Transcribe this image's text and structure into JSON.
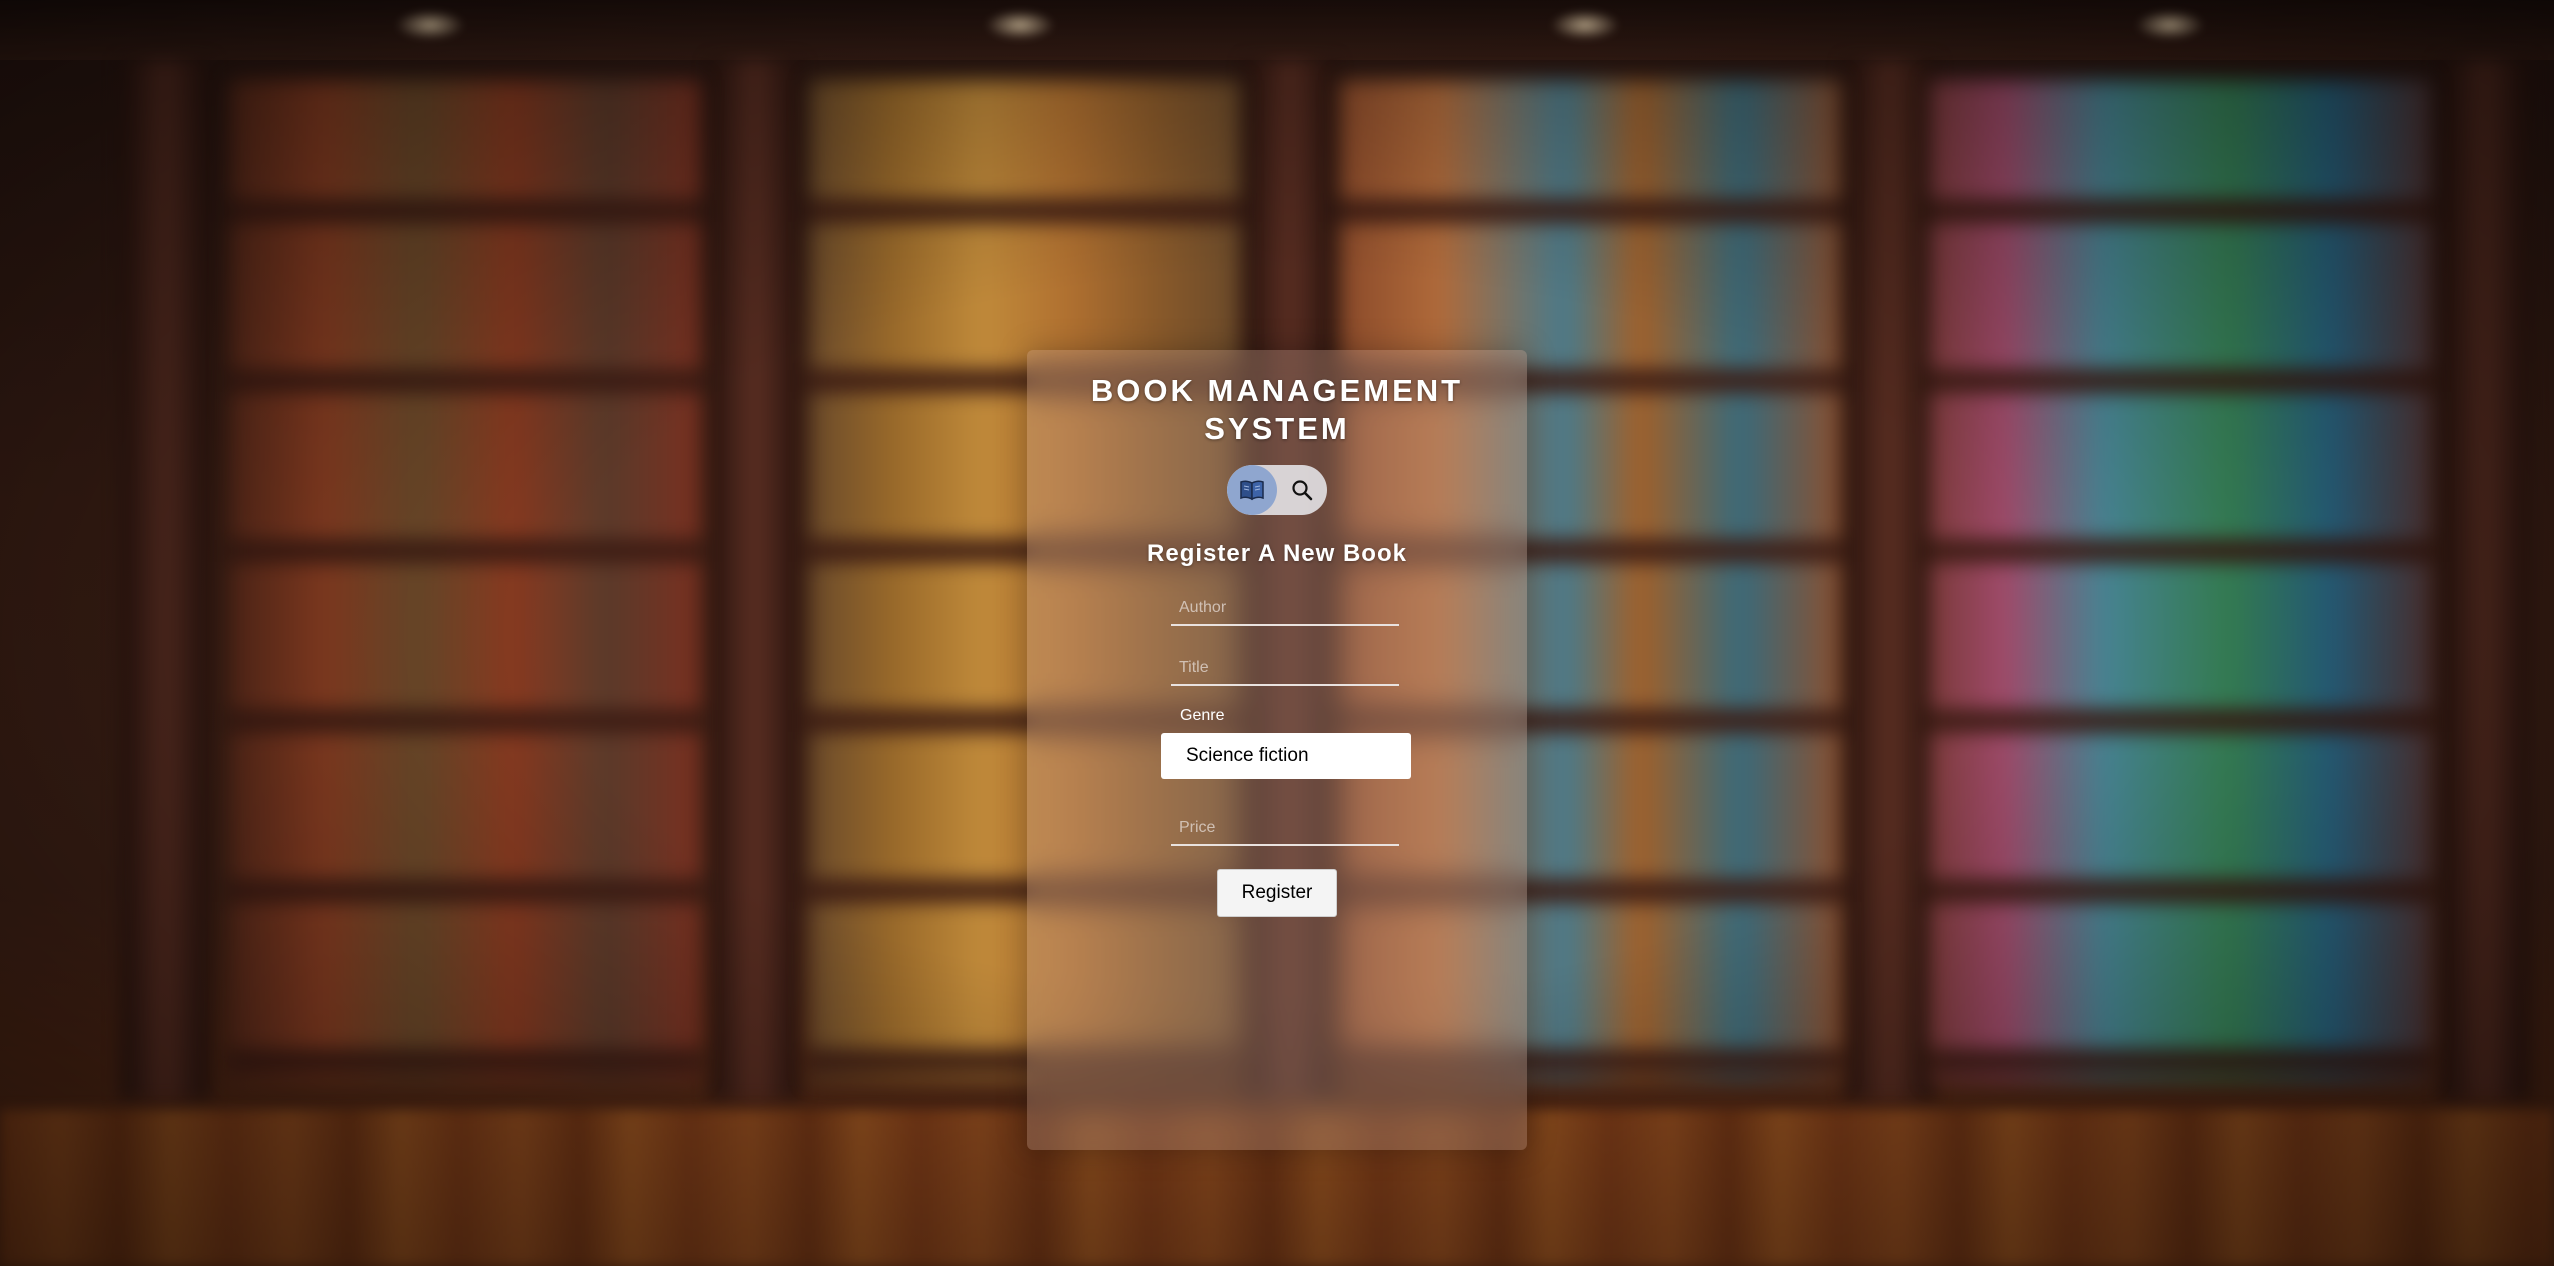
{
  "app": {
    "title": "BOOK MANAGEMENT SYSTEM"
  },
  "mode_toggle": {
    "options": [
      {
        "icon": "book-icon",
        "active": true
      },
      {
        "icon": "search-icon",
        "active": false
      }
    ]
  },
  "form": {
    "heading": "Register A New Book",
    "author": {
      "placeholder": "Author",
      "value": ""
    },
    "title": {
      "placeholder": "Title",
      "value": ""
    },
    "genre": {
      "label": "Genre",
      "selected": "Science fiction"
    },
    "price": {
      "placeholder": "Price",
      "value": ""
    },
    "submit_label": "Register"
  },
  "colors": {
    "panel": "#d2afa0",
    "toggle_active": "#8fa6cf",
    "text": "#ffffff"
  }
}
